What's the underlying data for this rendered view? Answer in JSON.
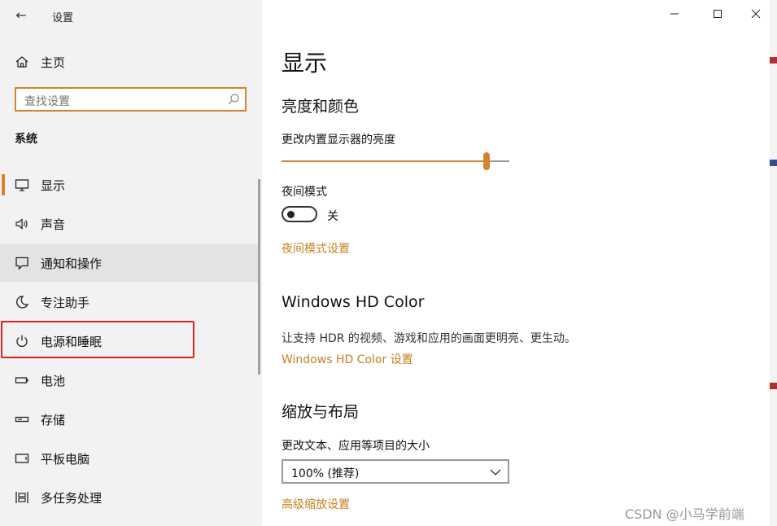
{
  "window": {
    "app_title": "设置",
    "back_glyph": "←",
    "minimize_glyph": "—",
    "maximize_glyph": "☐",
    "close_glyph": "✕"
  },
  "sidebar": {
    "home_label": "主页",
    "search_placeholder": "查找设置",
    "section_title": "系统",
    "items": [
      {
        "label": "显示",
        "icon": "monitor-icon",
        "active": true
      },
      {
        "label": "声音",
        "icon": "speaker-icon"
      },
      {
        "label": "通知和操作",
        "icon": "notification-icon",
        "hover": true
      },
      {
        "label": "专注助手",
        "icon": "moon-icon"
      },
      {
        "label": "电源和睡眠",
        "icon": "power-icon",
        "highlighted": true
      },
      {
        "label": "电池",
        "icon": "battery-icon"
      },
      {
        "label": "存储",
        "icon": "storage-icon"
      },
      {
        "label": "平板电脑",
        "icon": "tablet-icon"
      },
      {
        "label": "多任务处理",
        "icon": "multitask-icon"
      }
    ]
  },
  "main": {
    "page_title": "显示",
    "brightness_section": {
      "heading": "亮度和颜色",
      "slider_label": "更改内置显示器的亮度",
      "brightness_level": 0.9,
      "night_mode_label": "夜间模式",
      "night_mode_state": "关",
      "night_mode_link": "夜间模式设置"
    },
    "hdr_section": {
      "heading": "Windows HD Color",
      "description": "让支持 HDR 的视频、游戏和应用的画面更明亮、更生动。",
      "link": "Windows HD Color 设置"
    },
    "scale_section": {
      "heading": "缩放与布局",
      "label": "更改文本、应用等项目的大小",
      "selected_value": "100% (推荐)",
      "link": "高级缩放设置"
    }
  },
  "watermark": "CSDN @小马学前端",
  "colors": {
    "accent": "#d4832f",
    "link": "#c8801f",
    "sidebar_bg": "#f2f2f2",
    "highlight_box": "#e02020"
  }
}
